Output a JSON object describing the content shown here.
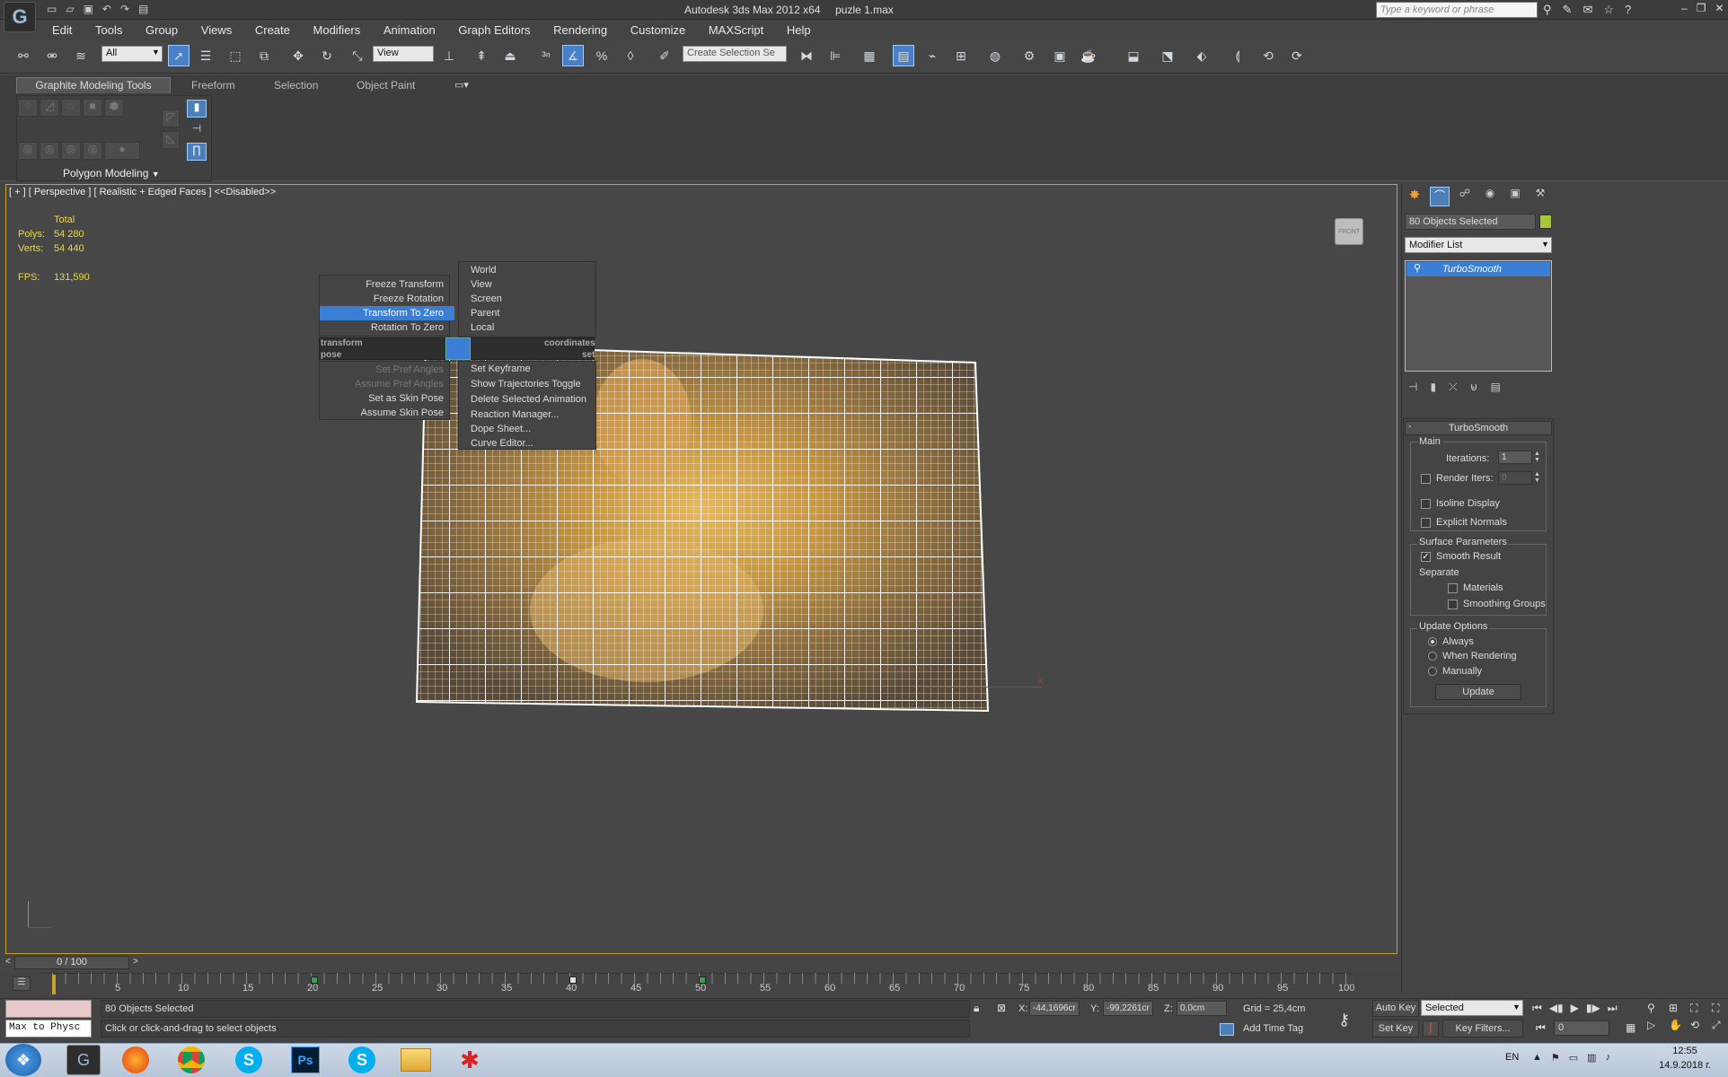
{
  "window": {
    "title": "Autodesk 3ds Max  2012 x64",
    "file": "puzle 1.max",
    "search_placeholder": "Type a keyword or phrase"
  },
  "menu": [
    "Edit",
    "Tools",
    "Group",
    "Views",
    "Create",
    "Modifiers",
    "Animation",
    "Graph Editors",
    "Rendering",
    "Customize",
    "MAXScript",
    "Help"
  ],
  "toolbar": {
    "filter": "All",
    "ref_coord": "View",
    "named_selection": "Create Selection Se"
  },
  "ribbon": {
    "tabs": [
      "Graphite Modeling Tools",
      "Freeform",
      "Selection",
      "Object Paint"
    ],
    "panel_label": "Polygon Modeling"
  },
  "viewport": {
    "label": "[ + ] [ Perspective ] [ Realistic + Edged Faces ] <<Disabled>>",
    "stats": {
      "total": "Total",
      "polys_label": "Polys:",
      "polys": "54 280",
      "verts_label": "Verts:",
      "verts": "54 440",
      "fps_label": "FPS:",
      "fps": "131,590"
    },
    "viewcube": "FRONT",
    "axis_label": "x"
  },
  "quadmenu": {
    "left_top": [
      "Freeze Transform",
      "Freeze Rotation",
      "Transform To Zero",
      "Rotation To Zero"
    ],
    "left_header": "transform",
    "left_header2": "pose",
    "left_bottom": [
      "Set Pref Angles",
      "Assume Pref Angles",
      "Set as Skin Pose",
      "Assume Skin Pose"
    ],
    "right_top": [
      "World",
      "View",
      "Screen",
      "Parent",
      "Local"
    ],
    "right_header": "coordinates",
    "right_header2": "set",
    "right_bottom": [
      "Set Keyframe",
      "Show Trajectories Toggle",
      "Delete Selected Animation",
      "Reaction Manager...",
      "Dope Sheet...",
      "Curve Editor..."
    ]
  },
  "command_panel": {
    "selection_name": "80 Objects Selected",
    "modifier_list": "Modifier List",
    "stack_item": "TurboSmooth",
    "rollout_title": "TurboSmooth",
    "main_group": "Main",
    "iterations_label": "Iterations:",
    "iterations": "1",
    "render_iters_label": "Render Iters:",
    "render_iters": "0",
    "isoline": "Isoline Display",
    "explicit_normals": "Explicit Normals",
    "surface_group": "Surface Parameters",
    "smooth_result": "Smooth Result",
    "separate": "Separate",
    "materials": "Materials",
    "smoothing_groups": "Smoothing Groups",
    "update_group": "Update Options",
    "always": "Always",
    "when_rendering": "When Rendering",
    "manually": "Manually",
    "update_btn": "Update"
  },
  "timeline": {
    "frame": "0 / 100",
    "ticks": [
      "5",
      "10",
      "15",
      "20",
      "25",
      "30",
      "35",
      "40",
      "45",
      "50",
      "55",
      "60",
      "65",
      "70",
      "75",
      "80",
      "85",
      "90",
      "95",
      "100"
    ]
  },
  "status": {
    "maxscript": "Max to Physc",
    "selected": "80 Objects Selected",
    "prompt": "Click or click-and-drag to select objects",
    "x_label": "X:",
    "x": "-44,1696cr",
    "y_label": "Y:",
    "y": "-99,2261cr",
    "z_label": "Z:",
    "z": "0,0cm",
    "grid": "Grid = 25,4cm",
    "add_time_tag": "Add Time Tag",
    "auto_key": "Auto Key",
    "set_key": "Set Key",
    "key_mode": "Selected",
    "key_filters": "Key Filters...",
    "frame_field": "0"
  },
  "taskbar": {
    "lang": "EN",
    "time": "12:55",
    "date": "14.9.2018 г."
  }
}
